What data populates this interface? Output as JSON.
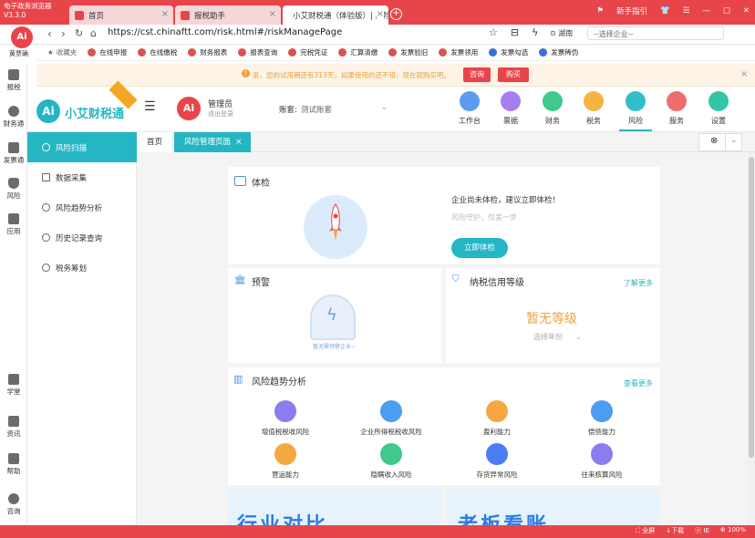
{
  "browser": {
    "app_title": "电子政务浏览器",
    "app_version": "V3.3.0",
    "tabs": [
      {
        "label": "首页",
        "active": false
      },
      {
        "label": "报税助手",
        "active": false
      },
      {
        "label": "小艾财税通（体验版）| 风险",
        "active": true
      }
    ],
    "top_right": {
      "beginner_label": "新手指引"
    },
    "url": "https://cst.chinaftt.com/risk.html#/riskManagePage",
    "region": "湖南",
    "company_select": "--选择企业--",
    "favorites_label": "收藏夹",
    "logo_label": "黄票确"
  },
  "bookmarks": [
    "在线申报",
    "在线缴税",
    "财务报表",
    "报表查询",
    "完税凭证",
    "汇算清缴",
    "发票验旧",
    "发票领用",
    "发票勾选",
    "发票稀伪"
  ],
  "notice": {
    "text": "亲，您的试用期还有313天，如果使用的还不错，现在就购买吧。",
    "inquire_label": "咨询",
    "buy_label": "购买"
  },
  "left_strip": {
    "top": [
      "报税",
      "财务通",
      "发票通",
      "风险",
      "应用"
    ],
    "bottom": [
      "学堂",
      "资讯",
      "帮助",
      "咨询"
    ]
  },
  "app": {
    "logo_text": "小艾财税通",
    "logo_mark": "Ai",
    "user_name": "管理员",
    "logout": "退出登录",
    "account_label": "账套:",
    "account_value": "测试账套",
    "topnav": [
      {
        "label": "工作台",
        "color": "#5b9bf2"
      },
      {
        "label": "票据",
        "color": "#a77ef0"
      },
      {
        "label": "财务",
        "color": "#3fc98c"
      },
      {
        "label": "税务",
        "color": "#f5b342"
      },
      {
        "label": "风险",
        "color": "#30bec9"
      },
      {
        "label": "服务",
        "color": "#f06d6d"
      },
      {
        "label": "设置",
        "color": "#32c5a6"
      }
    ],
    "active_nav": "风险"
  },
  "sidebar": [
    "风险扫描",
    "数据采集",
    "风险趋势分析",
    "历史记录查询",
    "税务筹划"
  ],
  "page_tabs": {
    "home": "首页",
    "risk": "风险管理页面"
  },
  "exam": {
    "title": "体检",
    "message": "企业尚未体检，建议立即体检！",
    "sub": "风险守护，仅差一步",
    "button": "立即体检"
  },
  "warning": {
    "title": "预警",
    "caption": "暂无需预警企业~"
  },
  "credit": {
    "title": "纳税信用等级",
    "more": "了解更多",
    "grade": "暂无等级",
    "year_select": "选择年份"
  },
  "trend": {
    "title": "风险趋势分析",
    "more": "查看更多",
    "items": [
      {
        "label": "增值税税收风险",
        "color": "#8b7cf0"
      },
      {
        "label": "企业所得税税收风险",
        "color": "#4a9df2"
      },
      {
        "label": "盈利能力",
        "color": "#f5a742"
      },
      {
        "label": "偿债能力",
        "color": "#4a9df2"
      },
      {
        "label": "营运能力",
        "color": "#f5a742"
      },
      {
        "label": "隐瞒收入风险",
        "color": "#3fc98c"
      },
      {
        "label": "存货异常风险",
        "color": "#4a7df2"
      },
      {
        "label": "往来核算风险",
        "color": "#8b7cf0"
      }
    ]
  },
  "banners": [
    "行业对比",
    "老板看账"
  ],
  "statusbar": [
    "全屏",
    "下载",
    "IE",
    "100%"
  ]
}
